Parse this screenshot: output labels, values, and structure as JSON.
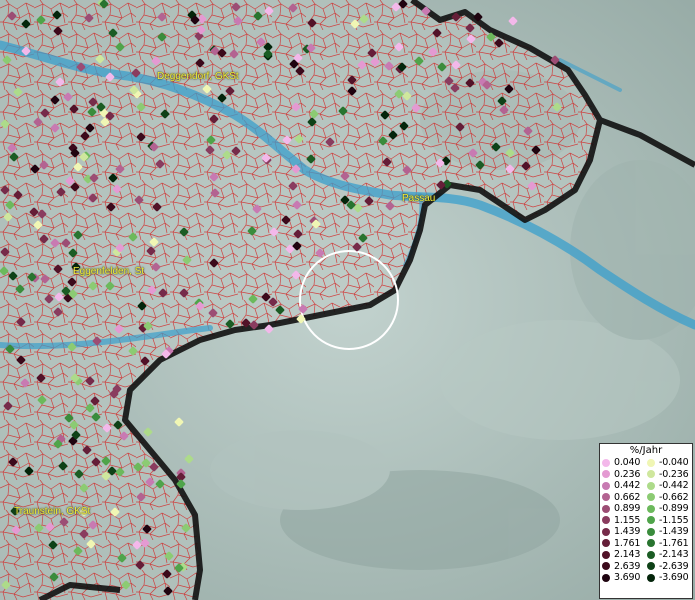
{
  "cities": [
    {
      "name": "Deggendorf, GKSt"
    },
    {
      "name": "Passau"
    },
    {
      "name": "Eggenfelden, St"
    },
    {
      "name": "Traunstein, GKSt"
    }
  ],
  "legend": {
    "title": "%/Jahr",
    "positive": [
      {
        "value": "0.040",
        "color": "#f3b8ea"
      },
      {
        "value": "0.236",
        "color": "#e49ad2"
      },
      {
        "value": "0.442",
        "color": "#c87ab2"
      },
      {
        "value": "0.662",
        "color": "#b36391"
      },
      {
        "value": "0.899",
        "color": "#9c4d74"
      },
      {
        "value": "1.155",
        "color": "#8a3c5f"
      },
      {
        "value": "1.439",
        "color": "#762b4a"
      },
      {
        "value": "1.761",
        "color": "#651e38"
      },
      {
        "value": "2.143",
        "color": "#521228"
      },
      {
        "value": "2.639",
        "color": "#3c0a1b"
      },
      {
        "value": "3.690",
        "color": "#1f0410"
      }
    ],
    "negative": [
      {
        "value": "-0.040",
        "color": "#f0f6b4"
      },
      {
        "value": "-0.236",
        "color": "#cfe79d"
      },
      {
        "value": "-0.442",
        "color": "#addb8a"
      },
      {
        "value": "-0.662",
        "color": "#8ccb73"
      },
      {
        "value": "-0.899",
        "color": "#6cb95c"
      },
      {
        "value": "-1.155",
        "color": "#4fa44a"
      },
      {
        "value": "-1.439",
        "color": "#3a8c3c"
      },
      {
        "value": "-1.761",
        "color": "#28742f"
      },
      {
        "value": "-2.143",
        "color": "#1b5c24"
      },
      {
        "value": "-2.639",
        "color": "#0e4117"
      },
      {
        "value": "-3.690",
        "color": "#04250b"
      }
    ]
  },
  "colors": {
    "river": "#3a9fcc",
    "border": "#111111",
    "municipality_lines": "#d22a2a",
    "label": "#f2ee3a",
    "highlight_circle": "#ffffff"
  }
}
